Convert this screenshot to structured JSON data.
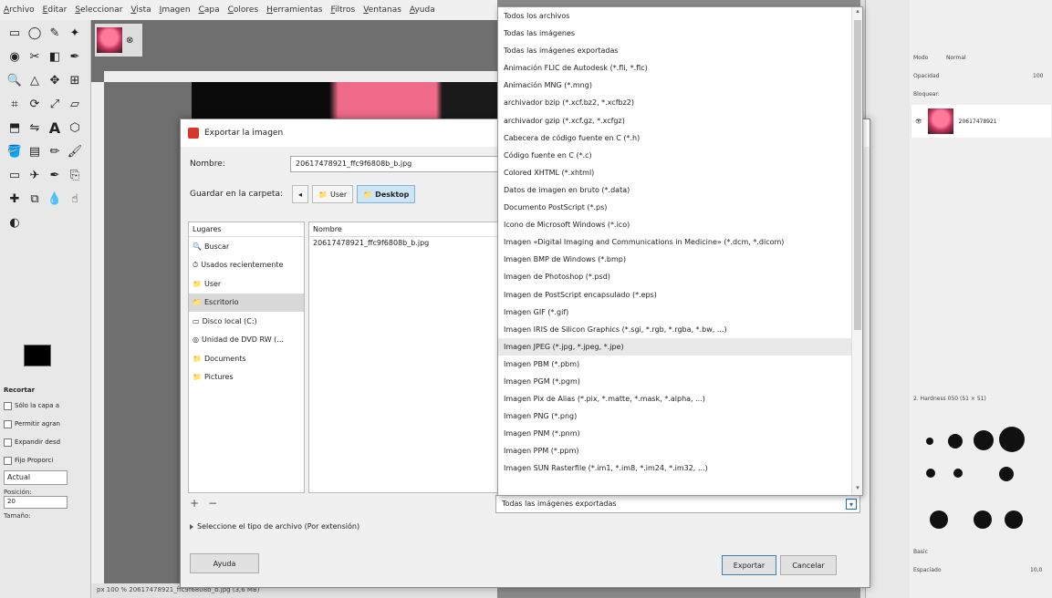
{
  "menubar": [
    "Archivo",
    "Editar",
    "Seleccionar",
    "Vista",
    "Imagen",
    "Capa",
    "Colores",
    "Herramientas",
    "Filtros",
    "Ventanas",
    "Ayuda"
  ],
  "tool_options": {
    "title": "Recortar",
    "checkboxes": [
      "Sólo la capa a",
      "Permitir agran",
      "Expandir desd",
      "Fijo Proporci"
    ],
    "current_select": "Actual",
    "position_label": "Posición:",
    "position_value": "20",
    "size_label": "Tamaño:"
  },
  "statusbar": "px  100 %  20617478921_ffc9f6808b_b.jpg (3,6 MB)",
  "dock": {
    "mode_label": "Modo",
    "mode_value": "Normal",
    "opacity_label": "Opacidad",
    "opacity_value": "100",
    "lock_label": "Bloquear:",
    "layer_name": "20617478921",
    "brush_name": "2. Hardness 050 (51 × 51)",
    "basic_label": "Basic",
    "spacing_label": "Espaciado",
    "spacing_value": "10,0"
  },
  "dialog": {
    "title": "Exportar la imagen",
    "name_label": "Nombre:",
    "name_value": "20617478921_ffc9f6808b_b.jpg",
    "folder_label": "Guardar en la carpeta:",
    "crumbs": [
      "User",
      "Desktop"
    ],
    "places_header": "Lugares",
    "places": [
      {
        "icon": "🔍",
        "label": "Buscar"
      },
      {
        "icon": "⏱",
        "label": "Usados recientemente"
      },
      {
        "icon": "📁",
        "label": "User"
      },
      {
        "icon": "📁",
        "label": "Escritorio"
      },
      {
        "icon": "▭",
        "label": "Disco local (C:)"
      },
      {
        "icon": "◎",
        "label": "Unidad de DVD RW (..."
      },
      {
        "icon": "📁",
        "label": "Documents"
      },
      {
        "icon": "📁",
        "label": "Pictures"
      }
    ],
    "files_header": "Nombre",
    "files": [
      "20617478921_ffc9f6808b_b.jpg"
    ],
    "filetype_label": "Seleccione el tipo de archivo (Por extensión)",
    "help_label": "Ayuda",
    "export_label": "Exportar",
    "cancel_label": "Cancelar",
    "filter_value": "Todas las imágenes exportadas"
  },
  "dropdown": [
    "Todos los archivos",
    "Todas las imágenes",
    "Todas las imágenes exportadas",
    "Animación FLIC de Autodesk (*.fli, *.flc)",
    "Animación MNG (*.mng)",
    "archivador bzip (*.xcf.bz2, *.xcfbz2)",
    "archivador gzip (*.xcf.gz, *.xcfgz)",
    "Cabecera de código fuente en C (*.h)",
    "Código fuente en C (*.c)",
    "Colored XHTML (*.xhtml)",
    "Datos de imagen en bruto (*.data)",
    "Documento PostScript (*.ps)",
    "Icono de Microsoft Windows (*.ico)",
    "Imagen «Digital Imaging and Communications in Medicine» (*.dcm, *.dicom)",
    "Imagen BMP de Windows (*.bmp)",
    "Imagen de Photoshop (*.psd)",
    "Imagen de PostScript encapsulado (*.eps)",
    "Imagen GIF (*.gif)",
    "Imagen IRIS de Silicon Graphics (*.sgi, *.rgb, *.rgba, *.bw, ...)",
    "Imagen JPEG (*.jpg, *.jpeg, *.jpe)",
    "Imagen PBM (*.pbm)",
    "Imagen PGM (*.pgm)",
    "Imagen Pix de Alias (*.pix, *.matte, *.mask, *.alpha, ...)",
    "Imagen PNG (*.png)",
    "Imagen PNM (*.pnm)",
    "Imagen PPM (*.ppm)",
    "Imagen SUN Rasterfile (*.im1, *.im8, *.im24, *.im32, ...)"
  ],
  "dropdown_selected_index": 19
}
